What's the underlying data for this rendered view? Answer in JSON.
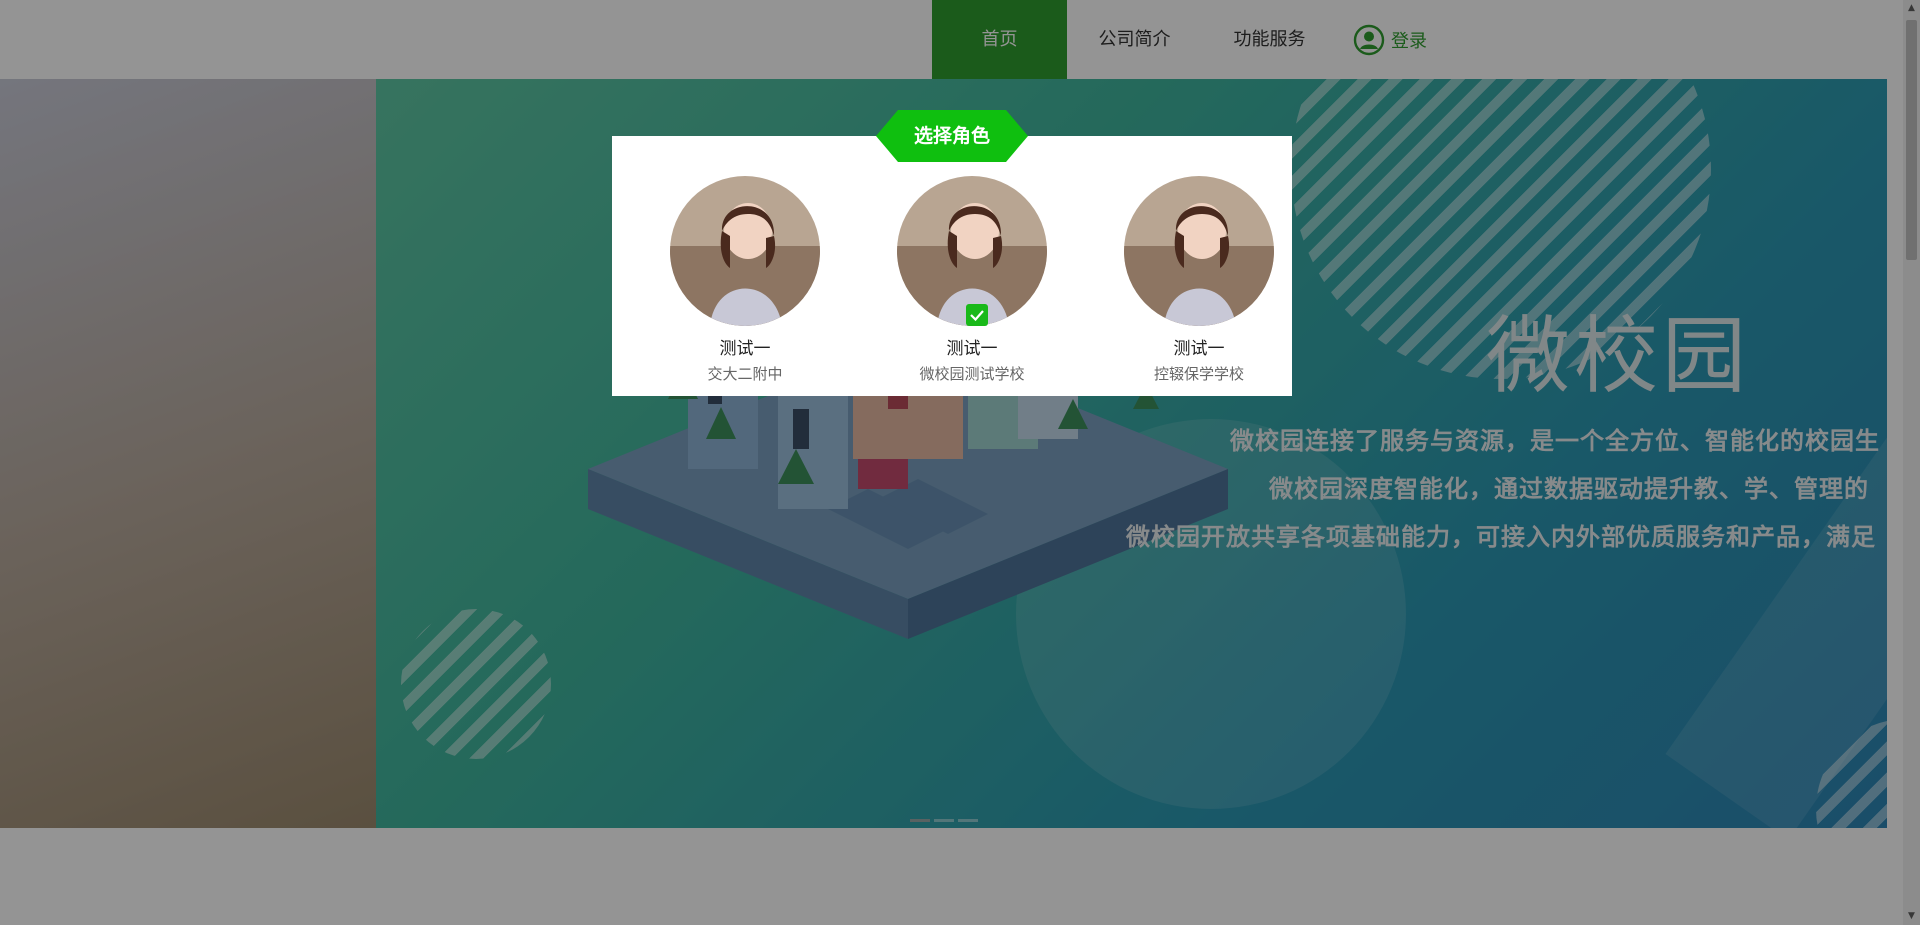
{
  "nav": {
    "items": [
      {
        "label": "首页",
        "active": true
      },
      {
        "label": "公司简介",
        "active": false
      },
      {
        "label": "功能服务",
        "active": false
      }
    ],
    "login_label": "登录",
    "accent": "#2f9e2f",
    "login_icon": "user-circle-icon"
  },
  "hero": {
    "title": "微校园",
    "lines": [
      "微校园连接了服务与资源，是一个全方位、智能化的校园生",
      "微校园深度智能化，通过数据驱动提升教、学、管理的",
      "微校园开放共享各项基础能力，可接入内外部优质服务和产品，满足"
    ]
  },
  "modal": {
    "title": "选择角色",
    "accent": "#0fbf0f",
    "roles": [
      {
        "name": "测试一",
        "school": "交大二附中",
        "selected": false
      },
      {
        "name": "测试一",
        "school": "微校园测试学校",
        "selected": true
      },
      {
        "name": "测试一",
        "school": "控辍保学学校",
        "selected": false
      }
    ]
  }
}
